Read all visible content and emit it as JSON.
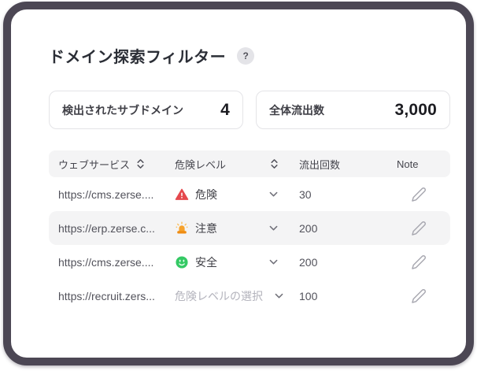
{
  "card": {
    "title": "ドメイン探索フィルター",
    "help_label": "?"
  },
  "stats": [
    {
      "label": "検出されたサブドメイン",
      "value": "4"
    },
    {
      "label": "全体流出数",
      "value": "3,000"
    }
  ],
  "table": {
    "headers": {
      "service": "ウェブサービス",
      "risk": "危険レベル",
      "count": "流出回数",
      "note": "Note"
    },
    "rows": [
      {
        "url": "https://cms.zerse....",
        "risk_label": "危険",
        "risk_level": "danger",
        "count": "30"
      },
      {
        "url": "https://erp.zerse.c...",
        "risk_label": "注意",
        "risk_level": "caution",
        "count": "200"
      },
      {
        "url": "https://cms.zerse....",
        "risk_label": "安全",
        "risk_level": "safe",
        "count": "200"
      },
      {
        "url": "https://recruit.zers...",
        "risk_label": "危険レベルの選択",
        "risk_level": "unselected",
        "count": "100"
      }
    ]
  },
  "icons": {
    "help": "question-circle",
    "sort": "up-down-chevrons",
    "dropdown": "chevron-down",
    "danger": "warning-triangle",
    "caution": "siren-light",
    "safe": "smiley-face",
    "note": "pencil"
  },
  "colors": {
    "danger": "#e5484d",
    "caution": "#f39b27",
    "safe": "#34c964",
    "frame": "#4c4754",
    "header_bg": "#f4f4f5"
  }
}
